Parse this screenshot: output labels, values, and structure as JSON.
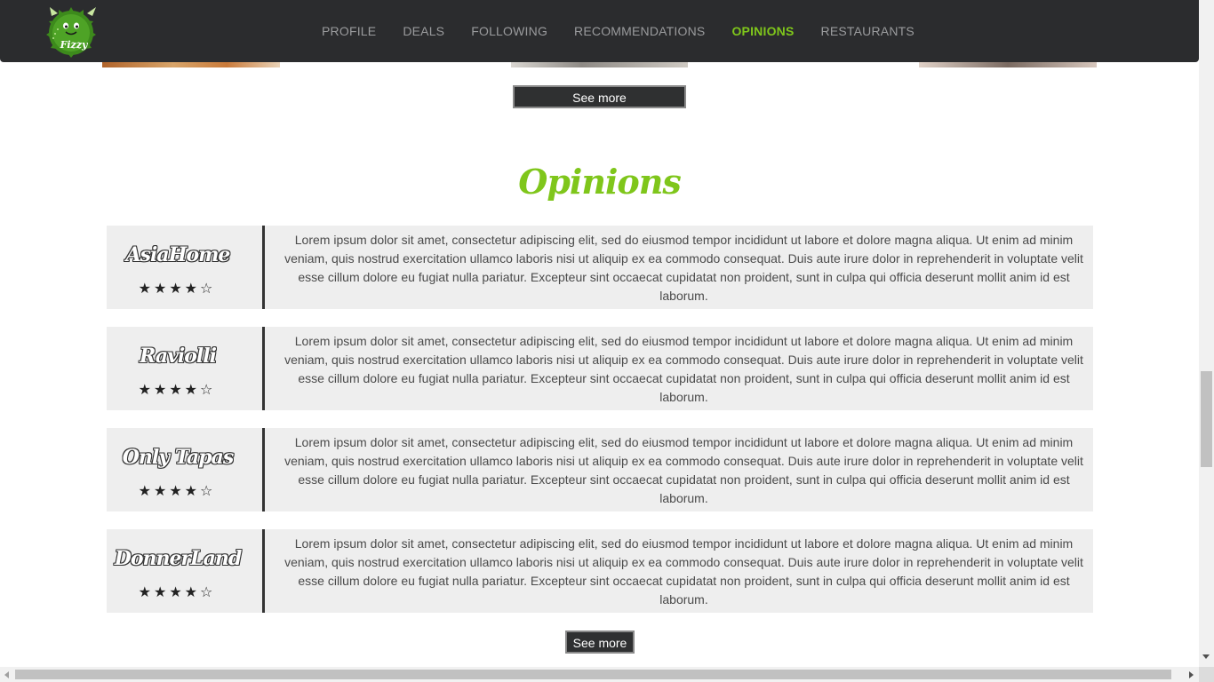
{
  "nav": {
    "items": [
      {
        "label": "PROFILE"
      },
      {
        "label": "DEALS"
      },
      {
        "label": "FOLLOWING"
      },
      {
        "label": "RECOMMENDATIONS"
      },
      {
        "label": "OPINIONS",
        "active": true
      },
      {
        "label": "RESTAURANTS"
      }
    ],
    "active_color": "#7fc61b",
    "background": "#2b2c2e"
  },
  "logo": {
    "icon": "green-monster-logo-icon",
    "text": "Fizzy"
  },
  "top_section": {
    "see_more_label": "See more"
  },
  "opinions": {
    "title": "Opinions",
    "items": [
      {
        "name": "AsiaHome",
        "stars": "★★★★☆",
        "rating": 4,
        "text": "Lorem ipsum dolor sit amet, consectetur adipiscing elit, sed do eiusmod tempor incididunt ut labore et dolore magna aliqua. Ut enim ad minim veniam, quis nostrud exercitation ullamco laboris nisi ut aliquip ex ea commodo consequat. Duis aute irure dolor in reprehenderit in voluptate velit esse cillum dolore eu fugiat nulla pariatur. Excepteur sint occaecat cupidatat non proident, sunt in culpa qui officia deserunt mollit anim id est laborum."
      },
      {
        "name": "Raviolli",
        "stars": "★★★★☆",
        "rating": 4,
        "text": "Lorem ipsum dolor sit amet, consectetur adipiscing elit, sed do eiusmod tempor incididunt ut labore et dolore magna aliqua. Ut enim ad minim veniam, quis nostrud exercitation ullamco laboris nisi ut aliquip ex ea commodo consequat. Duis aute irure dolor in reprehenderit in voluptate velit esse cillum dolore eu fugiat nulla pariatur. Excepteur sint occaecat cupidatat non proident, sunt in culpa qui officia deserunt mollit anim id est laborum."
      },
      {
        "name": "Only Tapas",
        "stars": "★★★★☆",
        "rating": 4,
        "text": "Lorem ipsum dolor sit amet, consectetur adipiscing elit, sed do eiusmod tempor incididunt ut labore et dolore magna aliqua. Ut enim ad minim veniam, quis nostrud exercitation ullamco laboris nisi ut aliquip ex ea commodo consequat. Duis aute irure dolor in reprehenderit in voluptate velit esse cillum dolore eu fugiat nulla pariatur. Excepteur sint occaecat cupidatat non proident, sunt in culpa qui officia deserunt mollit anim id est laborum."
      },
      {
        "name": "DonnerLand",
        "stars": "★★★★☆",
        "rating": 4,
        "text": "Lorem ipsum dolor sit amet, consectetur adipiscing elit, sed do eiusmod tempor incididunt ut labore et dolore magna aliqua. Ut enim ad minim veniam, quis nostrud exercitation ullamco laboris nisi ut aliquip ex ea commodo consequat. Duis aute irure dolor in reprehenderit in voluptate velit esse cillum dolore eu fugiat nulla pariatur. Excepteur sint occaecat cupidatat non proident, sunt in culpa qui officia deserunt mollit anim id est laborum."
      }
    ],
    "see_more_label": "See more"
  }
}
